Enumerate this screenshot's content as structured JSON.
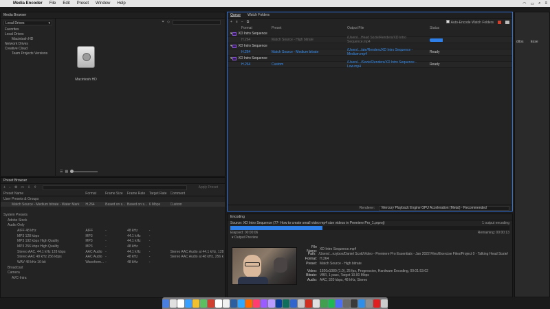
{
  "menubar": {
    "app": "Media Encoder",
    "items": [
      "File",
      "Edit",
      "Preset",
      "Window",
      "Help"
    ]
  },
  "media_browser": {
    "title": "Media Browser",
    "location": "Local Drives",
    "tree": [
      {
        "label": "Favorites",
        "level": 0
      },
      {
        "label": "Local Drives",
        "level": 0
      },
      {
        "label": "Macintosh HD",
        "level": 1
      },
      {
        "label": "Network Drives",
        "level": 0
      },
      {
        "label": "Creative Cloud",
        "level": 0
      },
      {
        "label": "Team Projects Versions",
        "level": 1
      }
    ],
    "disk_label": "Macintosh HD"
  },
  "queue": {
    "tabs": [
      "Queue",
      "Watch Folders"
    ],
    "auto_encode_label": "Auto-Encode Watch Folders",
    "columns": [
      "Format",
      "Preset",
      "Output File",
      "Status"
    ],
    "groups": [
      {
        "name": "XD Intro Sequence",
        "item": {
          "format": "H.264",
          "preset": "Match Source - High bitrate",
          "output": "/Users/...Head Sozie/Renders/XD Intro Sequence.mp4",
          "status": "",
          "progress": 0.95,
          "style": "dim"
        }
      },
      {
        "name": "XD Intro Sequence",
        "item": {
          "format": "H.264",
          "preset": "Match Source - Medium bitrate",
          "output": "/Users/.../ate/Renders/XD Intro Sequence - Medium.mp4",
          "status": "Ready",
          "style": "blue"
        }
      },
      {
        "name": "XD Intro Sequence",
        "item": {
          "format": "H.264",
          "preset": "Custom",
          "output": "/Users/.../Sozie/Renders/XD Intro Sequence - Low.mp4",
          "status": "Ready",
          "style": "blue"
        }
      }
    ],
    "renderer_label": "Renderer:",
    "renderer_value": "Mercury Playback Engine GPU Acceleration (Metal) - Recommended"
  },
  "preset_browser": {
    "title": "Preset Browser",
    "apply_label": "Apply Preset",
    "columns": [
      "Preset Name",
      "Format",
      "Frame Size",
      "Frame Rate",
      "Target Rate",
      "Comment"
    ],
    "rows": [
      {
        "name": "User Presets & Groups",
        "indent": 0,
        "fmt": "",
        "fs": "",
        "fr": "",
        "tr": "",
        "cm": ""
      },
      {
        "name": "Match Source - Medium bitrate - Water Mark",
        "indent": 2,
        "fmt": "H.264",
        "fs": "Based on s...",
        "fr": "Based on s...",
        "tr": "6 Mbps",
        "cm": "Custom",
        "selected": true
      },
      {
        "name": "",
        "indent": 0,
        "fmt": "",
        "fs": "",
        "fr": "",
        "tr": "",
        "cm": ""
      },
      {
        "name": "System Presets",
        "indent": 0,
        "fmt": "",
        "fs": "",
        "fr": "",
        "tr": "",
        "cm": ""
      },
      {
        "name": "Adobe Stock",
        "indent": 1,
        "fmt": "",
        "fs": "",
        "fr": "",
        "tr": "",
        "cm": ""
      },
      {
        "name": "Audio Only",
        "indent": 1,
        "fmt": "",
        "fs": "",
        "fr": "",
        "tr": "",
        "cm": ""
      },
      {
        "name": "AIFF 48 kHz",
        "indent": 3,
        "fmt": "AIFF",
        "fs": "-",
        "fr": "48 kHz",
        "tr": "-",
        "cm": ""
      },
      {
        "name": "MP3 128 kbps",
        "indent": 3,
        "fmt": "MP3",
        "fs": "-",
        "fr": "44.1 kHz",
        "tr": "-",
        "cm": ""
      },
      {
        "name": "MP3 192 kbps High Quality",
        "indent": 3,
        "fmt": "MP3",
        "fs": "-",
        "fr": "44.1 kHz",
        "tr": "-",
        "cm": ""
      },
      {
        "name": "MP3 256 kbps High Quality",
        "indent": 3,
        "fmt": "MP3",
        "fs": "-",
        "fr": "48 kHz",
        "tr": "-",
        "cm": ""
      },
      {
        "name": "Stereo AAC, 44.1 kHz 128 kbps",
        "indent": 3,
        "fmt": "AAC Audio",
        "fs": "-",
        "fr": "44.1 kHz",
        "tr": "-",
        "cm": "Stereo AAC Audio at 44.1 kHz, 128"
      },
      {
        "name": "Stereo AAC 48 kHz 256 kbps",
        "indent": 3,
        "fmt": "AAC Audio",
        "fs": "-",
        "fr": "48 kHz",
        "tr": "-",
        "cm": "Stereo AAC Audio at 48 kHz, 256 k"
      },
      {
        "name": "WAV 48 kHz 16-bit",
        "indent": 3,
        "fmt": "Waveform...",
        "fs": "-",
        "fr": "48 kHz",
        "tr": "-",
        "cm": ""
      },
      {
        "name": "Broadcast",
        "indent": 1,
        "fmt": "",
        "fs": "",
        "fr": "",
        "tr": "",
        "cm": ""
      },
      {
        "name": "Camera",
        "indent": 1,
        "fmt": "",
        "fs": "",
        "fr": "",
        "tr": "",
        "cm": ""
      },
      {
        "name": "AVC-Intra",
        "indent": 2,
        "fmt": "",
        "fs": "",
        "fr": "",
        "tr": "",
        "cm": ""
      }
    ]
  },
  "encoding": {
    "title": "Encoding",
    "source": "Source: XD Intro Sequence (77- How to create small video mp4 size videos in Premiere Pro_1.prproj)",
    "count": "1 output encoding",
    "elapsed": "Elapsed: 00:00:06",
    "remaining": "Remaining: 00:00:13",
    "progress": 0.33,
    "output_preview": "Output Preview",
    "meta": [
      {
        "k": "File Name:",
        "v": "XD Intro Sequence.mp4"
      },
      {
        "k": "Path:",
        "v": "/Users/...nzybox/Daniel Scott/Video - Premiere Pro Essentials - Jan 2022 Files/Exercise Files/Project 0 - Talking Head Sozie/Renders/"
      },
      {
        "k": "Format:",
        "v": "H.264"
      },
      {
        "k": "Preset:",
        "v": "Match Source - High bitrate"
      },
      {
        "k": "",
        "v": ""
      },
      {
        "k": "Video:",
        "v": "1920x1080 (1.0), 25 fps, Progressive, Hardware Encoding, 00:01:53:02"
      },
      {
        "k": "Bitrate:",
        "v": "VBR, 1 pass, Target 10.00 Mbps"
      },
      {
        "k": "Audio:",
        "v": "AAC, 320 kbps, 48 kHz, Stereo"
      }
    ]
  },
  "right_strip": {
    "tabs": [
      "ditos",
      "Esse"
    ]
  },
  "dock": {
    "colors": [
      "#4a7fe0",
      "#e0e0e0",
      "#ffffff",
      "#3aa0ff",
      "#f0c030",
      "#5bc060",
      "#d04030",
      "#ffffff",
      "#f0f0f0",
      "#2b5fa0",
      "#30a8ff",
      "#ff6a00",
      "#ff3d6e",
      "#9a5cff",
      "#b99cff",
      "#0a3fa0",
      "#0f6f5c",
      "#3366cc",
      "#c8c8c8",
      "#d03020",
      "#e0e0e0",
      "#40a050",
      "#1db954",
      "#4c6ef5",
      "#6a6a6a",
      "#3a3a3a",
      "#2f8fe8",
      "#8e8e8e",
      "#e02020",
      "#cccccc"
    ]
  }
}
